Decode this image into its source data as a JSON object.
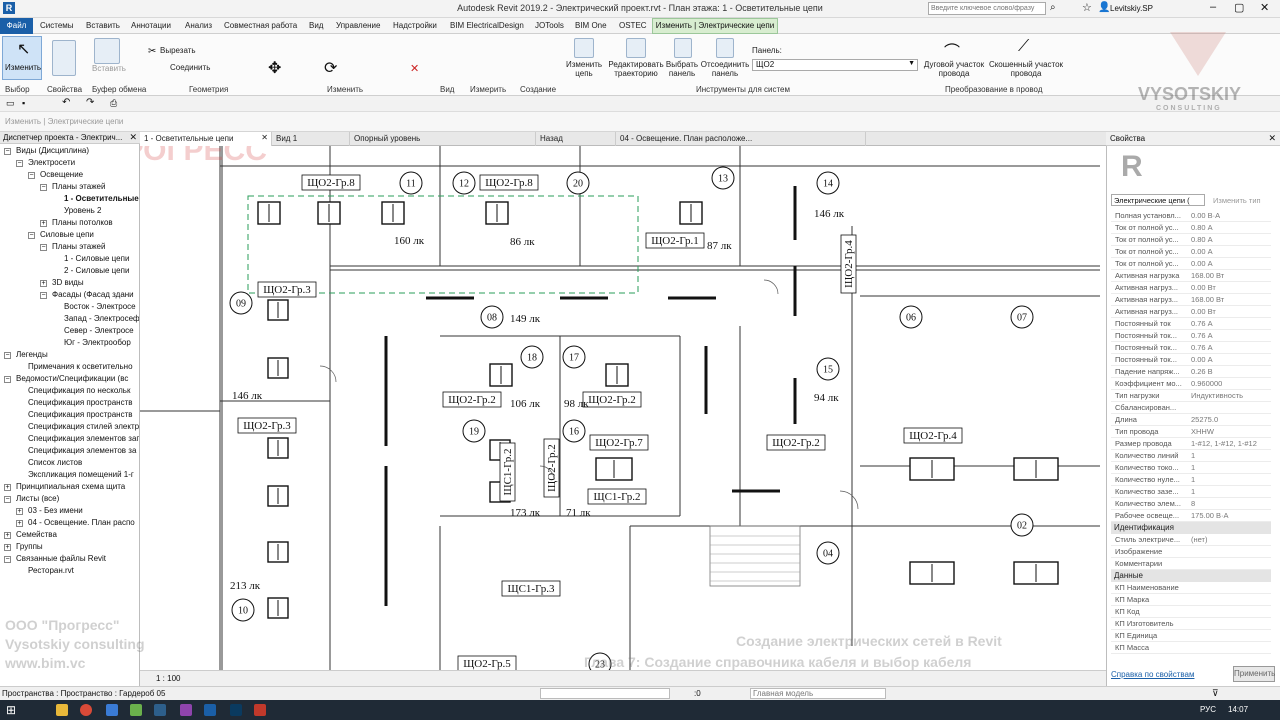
{
  "window": {
    "title": "Autodesk Revit 2019.2 - Электрический проект.rvt - План этажа: 1 - Осветительные цепи",
    "search_placeholder": "Введите ключевое слово/фразу",
    "user": "Levitskiy.SP"
  },
  "menu": {
    "file": "Файл",
    "items": [
      "Системы",
      "Вставить",
      "Аннотации",
      "Анализ",
      "Совместная работа",
      "Вид",
      "Управление",
      "Надстройки",
      "BIM ElectricalDesign",
      "JOTools",
      "BIM One",
      "OSTEC"
    ],
    "active_context": "Изменить | Электрические цепи"
  },
  "ribbon": {
    "modify_label": "Изменить",
    "insert_label": "Вставить",
    "cut": "Вырезать",
    "join": "Соединить",
    "panels": [
      "Выбор",
      "Свойства",
      "Буфер обмена",
      "Геометрия",
      "Изменить",
      "Вид",
      "Измерить",
      "Создание",
      "Инструменты для систем",
      "Преобразование в провод"
    ],
    "tools": [
      "Изменить цепь",
      "Редактировать траекторию",
      "Выбрать панель",
      "Отсоединить панель"
    ],
    "panel_field_label": "Панель:",
    "panel_value": "ЩО2",
    "arc_wire": "Дуговой участок провода",
    "chamfer_wire": "Скошенный участок провода"
  },
  "options_bar": {
    "text": "Изменить | Электрические цепи"
  },
  "project_browser": {
    "header": "Диспетчер проекта - Электрич...",
    "rows": [
      {
        "text": "Виды (Дисциплина)",
        "lvl": 0,
        "box": "−"
      },
      {
        "text": "Электросети",
        "lvl": 1,
        "box": "−"
      },
      {
        "text": "Освещение",
        "lvl": 2,
        "box": "−"
      },
      {
        "text": "Планы этажей",
        "lvl": 3,
        "box": "−"
      },
      {
        "text": "1 - Осветительные",
        "lvl": 4,
        "box": "",
        "bold": true
      },
      {
        "text": "Уровень 2",
        "lvl": 4,
        "box": ""
      },
      {
        "text": "Планы потолков",
        "lvl": 3,
        "box": "+"
      },
      {
        "text": "Силовые цепи",
        "lvl": 2,
        "box": "−"
      },
      {
        "text": "Планы этажей",
        "lvl": 3,
        "box": "−"
      },
      {
        "text": "1 - Силовые цепи",
        "lvl": 4,
        "box": ""
      },
      {
        "text": "2 - Силовые цепи",
        "lvl": 4,
        "box": ""
      },
      {
        "text": "3D виды",
        "lvl": 3,
        "box": "+"
      },
      {
        "text": "Фасады (Фасад здани",
        "lvl": 3,
        "box": "−"
      },
      {
        "text": "Восток - Электросе",
        "lvl": 4,
        "box": ""
      },
      {
        "text": "Запад - Электросеф",
        "lvl": 4,
        "box": ""
      },
      {
        "text": "Север - Электросе",
        "lvl": 4,
        "box": ""
      },
      {
        "text": "Юг - Электрообор",
        "lvl": 4,
        "box": ""
      },
      {
        "text": "Легенды",
        "lvl": 0,
        "box": "−"
      },
      {
        "text": "Примечания к осветительно",
        "lvl": 1,
        "box": ""
      },
      {
        "text": "Ведомости/Спецификации (вс",
        "lvl": 0,
        "box": "−"
      },
      {
        "text": "Спецификация по нескольк",
        "lvl": 1,
        "box": ""
      },
      {
        "text": "Спецификация пространств",
        "lvl": 1,
        "box": ""
      },
      {
        "text": "Спецификация пространств",
        "lvl": 1,
        "box": ""
      },
      {
        "text": "Спецификация стилей электр",
        "lvl": 1,
        "box": ""
      },
      {
        "text": "Спецификация элементов зап",
        "lvl": 1,
        "box": ""
      },
      {
        "text": "Спецификация элементов за",
        "lvl": 1,
        "box": ""
      },
      {
        "text": "Список листов",
        "lvl": 1,
        "box": ""
      },
      {
        "text": "Экспликация помещений 1-г",
        "lvl": 1,
        "box": ""
      },
      {
        "text": "Принципиальная схема щита",
        "lvl": 0,
        "box": "+"
      },
      {
        "text": "Листы (все)",
        "lvl": 0,
        "box": "−"
      },
      {
        "text": "03 - Без имени",
        "lvl": 1,
        "box": "+"
      },
      {
        "text": "04 - Освещение. План распо",
        "lvl": 1,
        "box": "+"
      },
      {
        "text": "Семейства",
        "lvl": 0,
        "box": "+"
      },
      {
        "text": "Группы",
        "lvl": 0,
        "box": "+"
      },
      {
        "text": "Связанные файлы Revit",
        "lvl": 0,
        "box": "−"
      },
      {
        "text": "Ресторан.rvt",
        "lvl": 1,
        "box": ""
      }
    ]
  },
  "view_tabs": [
    {
      "label": "1 - Осветительные цепи",
      "active": true
    },
    {
      "label": "Вид 1",
      "active": false
    },
    {
      "label": "Опорный уровень",
      "active": false
    },
    {
      "label": "Назад",
      "active": false
    },
    {
      "label": "04 - Освещение. План расположе...",
      "active": false
    }
  ],
  "plan": {
    "tags": [
      "ЩО2-Гр.8",
      "ЩО2-Гр.8",
      "ЩО2-Гр.1",
      "ЩО2-Гр.3",
      "ЩО2-Гр.4",
      "ЩО2-Гр.2",
      "ЩО2-Гр.2",
      "ЩО2-Гр.3",
      "ЩО2-Гр.2",
      "ЩО2-Гр.4",
      "ЩО2-Гр.7",
      "ЩС1-Гр.2",
      "ЩО2-Гр.2",
      "ЩС1-Гр.2",
      "ЩС1-Гр.3",
      "ЩО2-Гр.5"
    ],
    "rooms": [
      "11",
      "12",
      "20",
      "13",
      "14",
      "09",
      "08",
      "06",
      "07",
      "18",
      "17",
      "15",
      "19",
      "16",
      "02",
      "04",
      "10",
      "23"
    ],
    "lux": [
      "160 лк",
      "86 лк",
      "87 лк",
      "146 лк",
      "149 лк",
      "146 лк",
      "106 лк",
      "98 лк",
      "94 лк",
      "173 лк",
      "71 лк",
      "213 лк"
    ]
  },
  "properties": {
    "header": "Свойства",
    "type_selector": "Электрические цепи (",
    "edit_type": "Изменить тип",
    "rows": [
      {
        "k": "Полная установл...",
        "v": "0.00 В·А"
      },
      {
        "k": "Ток от полной ус...",
        "v": "0.80 А"
      },
      {
        "k": "Ток от полной ус...",
        "v": "0.80 А"
      },
      {
        "k": "Ток от полной ус...",
        "v": "0.00 А"
      },
      {
        "k": "Ток от полной ус...",
        "v": "0.00 А"
      },
      {
        "k": "Активная нагрузка",
        "v": "168.00 Вт"
      },
      {
        "k": "Активная нагруз...",
        "v": "0.00 Вт"
      },
      {
        "k": "Активная нагруз...",
        "v": "168.00 Вт"
      },
      {
        "k": "Активная нагруз...",
        "v": "0.00 Вт"
      },
      {
        "k": "Постоянный ток",
        "v": "0.76 А"
      },
      {
        "k": "Постоянный ток...",
        "v": "0.76 А"
      },
      {
        "k": "Постоянный ток...",
        "v": "0.76 А"
      },
      {
        "k": "Постоянный ток...",
        "v": "0.00 А"
      },
      {
        "k": "Падение напряж...",
        "v": "0.26 В"
      },
      {
        "k": "Коэффициент мо...",
        "v": "0.960000"
      },
      {
        "k": "Тип нагрузки",
        "v": "Индуктивность"
      },
      {
        "k": "Сбалансирован...",
        "v": ""
      },
      {
        "k": "Длина",
        "v": "25275.0"
      },
      {
        "k": "Тип провода",
        "v": "ХННW"
      },
      {
        "k": "Размер провода",
        "v": "1-#12, 1-#12, 1-#12"
      },
      {
        "k": "Количество линий",
        "v": "1"
      },
      {
        "k": "Количество токо...",
        "v": "1"
      },
      {
        "k": "Количество нуле...",
        "v": "1"
      },
      {
        "k": "Количество зазе...",
        "v": "1"
      },
      {
        "k": "Количество элем...",
        "v": "8"
      },
      {
        "k": "Рабочее освеще...",
        "v": "175.00 В·А"
      }
    ],
    "section_ident": "Идентификация",
    "ident_rows": [
      {
        "k": "Стиль электриче...",
        "v": "(нет)"
      },
      {
        "k": "Изображение",
        "v": ""
      },
      {
        "k": "Комментарии",
        "v": ""
      }
    ],
    "section_data": "Данные",
    "data_rows": [
      {
        "k": "КП Наименование",
        "v": ""
      },
      {
        "k": "КП Марка",
        "v": ""
      },
      {
        "k": "КП Код",
        "v": ""
      },
      {
        "k": "КП Изготовитель",
        "v": ""
      },
      {
        "k": "КП Единица",
        "v": ""
      },
      {
        "k": "КП Масса",
        "v": ""
      }
    ],
    "help_link": "Справка по свойствам",
    "apply": "Применить"
  },
  "view_control": {
    "scale": "1 : 100"
  },
  "status": {
    "left": "Пространства : Пространство : Гардероб 05",
    "zero": ":0",
    "model": "Главная модель"
  },
  "watermarks": {
    "company": "ООО \"Прогресс\"",
    "consulting": "Vysotskiy consulting",
    "site": "www.bim.vc",
    "course1": "Создание электрических сетей в Revit",
    "course2": "Глава 7: Создание справочника кабеля и выбор кабеля",
    "logo_vys": "VYSOTSKIY",
    "logo_cons": "CONSULTING",
    "logo_prog": "ПРОГРЕСС"
  },
  "taskbar": {
    "lang": "РУС",
    "time": "14:07"
  }
}
